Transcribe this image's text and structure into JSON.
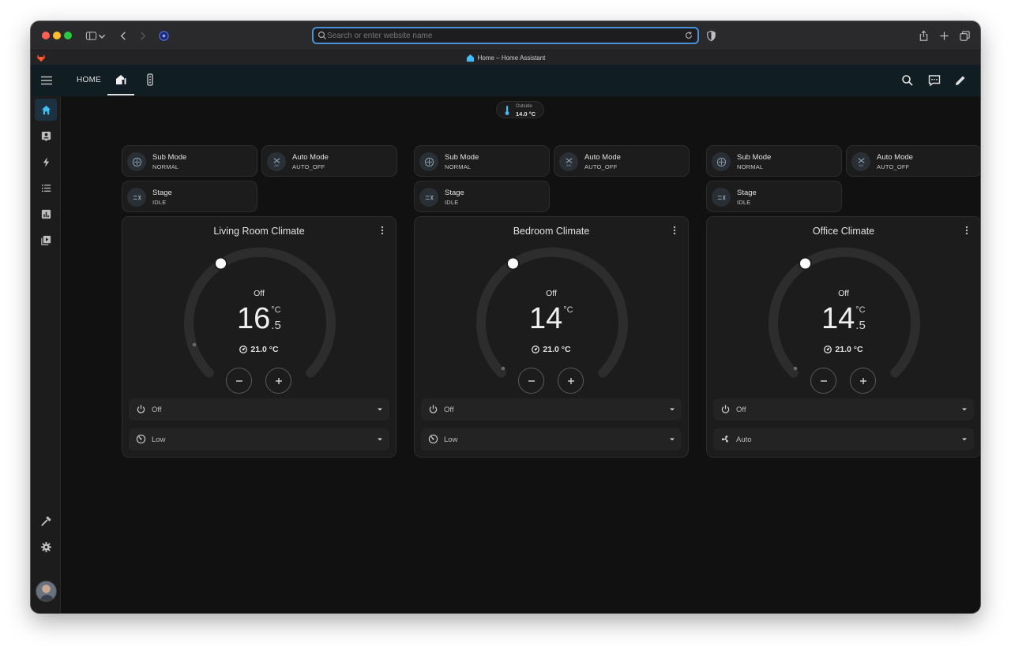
{
  "browser": {
    "address_placeholder": "Search or enter website name",
    "tab_title": "Home – Home Assistant"
  },
  "header": {
    "view_home_label": "HOME"
  },
  "outside": {
    "label": "Outside",
    "value": "14.0 °C"
  },
  "columns": [
    {
      "tiles": [
        {
          "name": "Sub Mode",
          "state": "NORMAL",
          "icon": "sub-mode-icon"
        },
        {
          "name": "Auto Mode",
          "state": "AUTO_OFF",
          "icon": "ac-icon"
        },
        {
          "name": "Stage",
          "state": "IDLE",
          "icon": "stage-icon"
        }
      ],
      "card": {
        "title": "Living Room Climate",
        "mode": "Off",
        "target_int": "16",
        "target_dec": ".5",
        "unit": "°C",
        "current": "21.0 °C",
        "hvac_select": "Off",
        "fan_select": "Low",
        "fan_icon": "fan-speed-icon"
      }
    },
    {
      "tiles": [
        {
          "name": "Sub Mode",
          "state": "NORMAL",
          "icon": "sub-mode-icon"
        },
        {
          "name": "Auto Mode",
          "state": "AUTO_OFF",
          "icon": "ac-icon"
        },
        {
          "name": "Stage",
          "state": "IDLE",
          "icon": "stage-icon"
        }
      ],
      "card": {
        "title": "Bedroom Climate",
        "mode": "Off",
        "target_int": "14",
        "target_dec": "",
        "unit": "°C",
        "current": "21.0 °C",
        "hvac_select": "Off",
        "fan_select": "Low",
        "fan_icon": "fan-speed-icon"
      }
    },
    {
      "tiles": [
        {
          "name": "Sub Mode",
          "state": "NORMAL",
          "icon": "sub-mode-icon"
        },
        {
          "name": "Auto Mode",
          "state": "AUTO_OFF",
          "icon": "ac-icon"
        },
        {
          "name": "Stage",
          "state": "IDLE",
          "icon": "stage-icon"
        }
      ],
      "card": {
        "title": "Office Climate",
        "mode": "Off",
        "target_int": "14",
        "target_dec": ".5",
        "unit": "°C",
        "current": "21.0 °C",
        "hvac_select": "Off",
        "fan_select": "Auto",
        "fan_icon": "fan-icon"
      }
    }
  ],
  "colors": {
    "background": "#111111",
    "card": "#1c1c1c",
    "header": "#101e24",
    "accent": "#4a90d9",
    "active_nav": "#1d3240"
  }
}
